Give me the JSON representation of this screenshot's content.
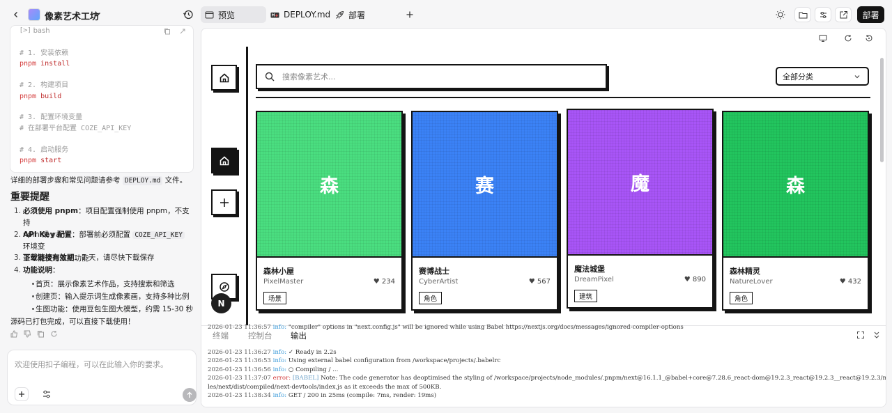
{
  "project": {
    "name": "像素艺术工坊"
  },
  "tabs": [
    {
      "label": "预览",
      "icon": "preview-icon",
      "active": true
    },
    {
      "label": "DEPLOY.md",
      "icon": "markdown-icon",
      "active": false
    },
    {
      "label": "部署",
      "icon": "rocket-icon",
      "active": false
    }
  ],
  "topbar": {
    "deploy_label": "部署"
  },
  "code_block": {
    "lang": "bash",
    "lines": [
      {
        "type": "comment",
        "text": "# 1. 安装依赖"
      },
      {
        "type": "cmd",
        "cmd": "pnpm",
        "arg": "install"
      },
      {
        "type": "blank",
        "text": ""
      },
      {
        "type": "comment",
        "text": "# 2. 构建项目"
      },
      {
        "type": "cmd",
        "cmd": "pnpm",
        "arg": "build"
      },
      {
        "type": "blank",
        "text": ""
      },
      {
        "type": "comment",
        "text": "# 3. 配置环境变量"
      },
      {
        "type": "comment",
        "text": "# 在部署平台配置 COZE_API_KEY"
      },
      {
        "type": "blank",
        "text": ""
      },
      {
        "type": "comment",
        "text": "# 4. 启动服务"
      },
      {
        "type": "cmd",
        "cmd": "pnpm",
        "arg": "start"
      }
    ]
  },
  "chat": {
    "deploy_note_pre": "详细的部署步骤和常见问题请参考",
    "deploy_note_code": "DEPLOY.md",
    "deploy_note_post": "文件。",
    "notes_title": "重要提醒",
    "items": [
      {
        "num": "1.",
        "bold": "必须使用 pnpm",
        "text": "：项目配置强制使用 pnpm，不支持",
        "text2": "npm 或 yarn"
      },
      {
        "num": "2.",
        "bold": "API Key 配置",
        "text": "：部署前必须配置",
        "code": "COZE_API_KEY",
        "text_after": "环境变",
        "text2": "量才能使用生图功能"
      },
      {
        "num": "3.",
        "bold": "下载链接有效期",
        "text": "：7 天，请尽快下载保存"
      },
      {
        "num": "4.",
        "bold": "功能说明",
        "text": "："
      }
    ],
    "sub_items": [
      "首页：展示像素艺术作品，支持搜索和筛选",
      "创建页：输入提示词生成像素画，支持多种比例",
      "生图功能：使用豆包生图大模型，约需 15-30 秒"
    ],
    "final_note": "源码已打包完成，可以直接下载使用！",
    "input_placeholder": "欢迎使用扣子编程，可以在此输入你的要求。"
  },
  "app": {
    "search_placeholder": "搜索像素艺术...",
    "category_selected": "全部分类",
    "cards": [
      {
        "glyph": "森",
        "title": "森林小屋",
        "author": "PixelMaster",
        "likes": "234",
        "tag": "场景",
        "color": "#4ade80"
      },
      {
        "glyph": "赛",
        "title": "赛博战士",
        "author": "CyberArtist",
        "likes": "567",
        "tag": "角色",
        "color": "#3b82f6"
      },
      {
        "glyph": "魔",
        "title": "魔法城堡",
        "author": "DreamPixel",
        "likes": "890",
        "tag": "建筑",
        "color": "#a855f7"
      },
      {
        "glyph": "森",
        "title": "森林精灵",
        "author": "NatureLover",
        "likes": "432",
        "tag": "角色",
        "color": "#22c55e"
      }
    ],
    "stub_colors": [
      "#f59e0b",
      "#06b6d4",
      "#ec4899",
      "#ef4444"
    ],
    "avatar_letter": "N"
  },
  "terminal": {
    "tabs": [
      "终端",
      "控制台",
      "输出"
    ],
    "active_tab": "输出",
    "logs": [
      {
        "ts": "2026-01-23 11:36:57",
        "level": "info:",
        "msg": " \"compiler\" options in \"next.config.js\" will be ignored while using Babel https://nextjs.org/docs/messages/ignored-compiler-options"
      },
      {
        "ts": "2026-01-23 11:36:27",
        "level": "info:",
        "msg": " ✓ Ready in 2.2s"
      },
      {
        "ts": "2026-01-23 11:36:53",
        "level": "info:",
        "msg": " Using external babel configuration from /workspace/projects/.babelrc"
      },
      {
        "ts": "2026-01-23 11:36:56",
        "level": "info:",
        "msg": " ○ Compiling / ..."
      },
      {
        "ts": "2026-01-23 11:37:07",
        "level": "error:",
        "tag": "[BABEL]",
        "msg": " Note: The code generator has deoptimised the styling of /workspace/projects/node_modules/.pnpm/next@16.1.1_@babel+core@7.28.6_react-dom@19.2.3_react@19.2.3__react@19.2.3/node_modu",
        "cont": "les/next/dist/compiled/next-devtools/index.js as it exceeds the max of 500KB."
      },
      {
        "ts": "2026-01-23 11:38:34",
        "level": "info:",
        "msg": " GET / 200 in 25ms (compile: 7ms, render: 19ms)"
      }
    ]
  }
}
